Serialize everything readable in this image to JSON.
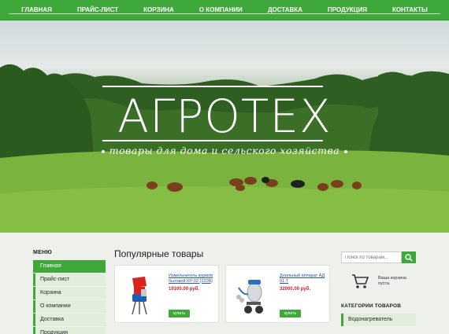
{
  "nav": {
    "items": [
      "Главная",
      "Прайс-лист",
      "Корзина",
      "О компании",
      "Доставка",
      "Продукция",
      "Контакты"
    ]
  },
  "hero": {
    "title": "АГРОТЕХ",
    "tagline": "товары для дома и сельского хозяйства"
  },
  "sidebar": {
    "title": "МЕНЮ",
    "items": [
      "Главная",
      "Прайс-лист",
      "Корзина",
      "О компании",
      "Доставка",
      "Продукция"
    ]
  },
  "main": {
    "title": "Популярные товары",
    "products": [
      {
        "name": "Измельчитель кормов бытовой КР-02 (220В)",
        "price": "19100.00 руб.",
        "buy": "купить"
      },
      {
        "name": "Доильный аппарат АД 01 Т",
        "price": "32000.00 руб.",
        "buy": "купить"
      }
    ]
  },
  "search": {
    "placeholder": "Поиск по товарам..."
  },
  "cart": {
    "line1": "Ваша корзина",
    "line2": "пуста."
  },
  "categories": {
    "title": "КАТЕГОРИИ ТОВАРОВ",
    "items": [
      "Водонагреватель"
    ]
  },
  "colors": {
    "accent": "#3fa83b",
    "price": "#d61f1f",
    "link": "#2a54a8"
  }
}
